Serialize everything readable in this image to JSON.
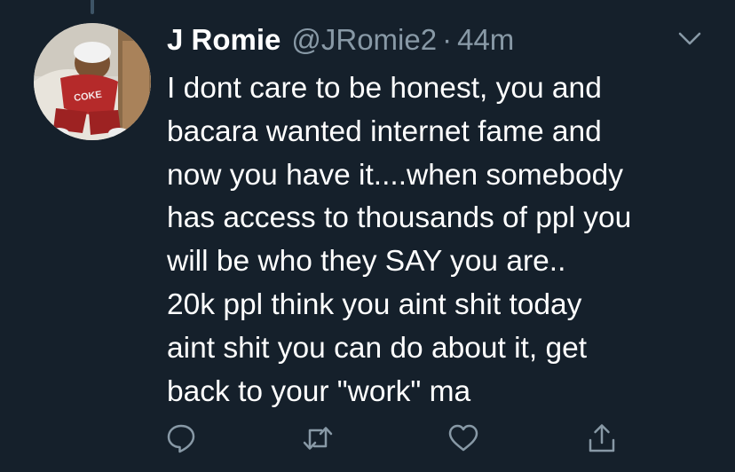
{
  "tweet": {
    "display_name": "J Romie",
    "handle": "@JRomie2",
    "separator": "·",
    "timestamp": "44m",
    "body_lines": [
      "I dont care to be honest, you and",
      "bacara wanted internet fame and",
      "now you have it....when somebody",
      "has access to thousands of ppl you",
      "will be who they SAY you are..",
      "20k ppl think you aint shit today",
      "aint shit you can do about it, get",
      "back to your \"work\" ma"
    ],
    "avatar_print": "COKE"
  },
  "actions": {
    "icons": [
      "reply-icon",
      "retweet-icon",
      "like-icon",
      "share-icon"
    ]
  },
  "colors": {
    "background": "#15202b",
    "text_primary": "#ffffff",
    "text_secondary": "#8899a6",
    "thread_line": "#3d5466"
  }
}
